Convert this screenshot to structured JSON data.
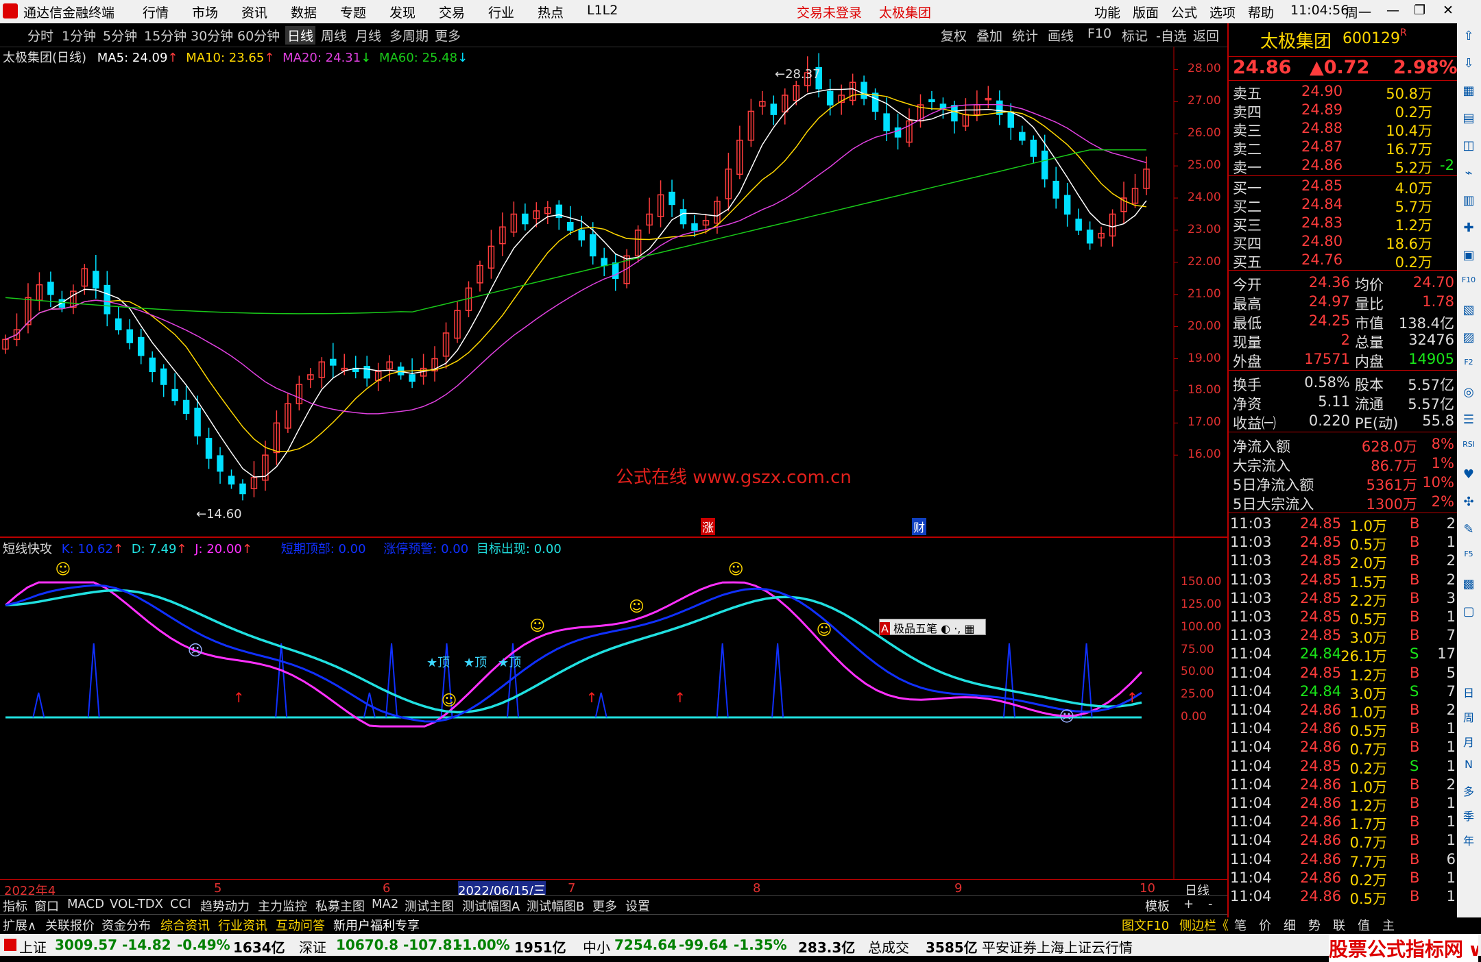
{
  "app": {
    "title": "通达信金融终端",
    "menu": [
      "行情",
      "市场",
      "资讯",
      "数据",
      "专题",
      "发现",
      "交易",
      "行业",
      "热点",
      "L1L2"
    ],
    "trade_status": "交易未登录",
    "stock_title": "太极集团",
    "right_menu": [
      "功能",
      "版面",
      "公式",
      "选项",
      "帮助"
    ],
    "time": "11:04:56",
    "weekday": "周一"
  },
  "tabs": {
    "periods": [
      "分时",
      "1分钟",
      "5分钟",
      "15分钟",
      "30分钟",
      "60分钟",
      "日线",
      "周线",
      "月线",
      "多周期",
      "更多"
    ],
    "selected": "日线",
    "tools": [
      "复权",
      "叠加",
      "统计",
      "画线",
      "F10",
      "标记",
      "-自选",
      "返回"
    ]
  },
  "main_chart": {
    "header": "太极集团(日线)",
    "ma5": "MA5: 24.09",
    "ma10": "MA10: 23.65",
    "ma20": "MA20: 24.31",
    "ma60": "MA60: 25.48",
    "high_label": "28.37",
    "low_label": "14.60",
    "watermark": "公式在线  www.gszx.com.cn",
    "marker_zhang": "涨",
    "marker_cai": "财",
    "y_ticks": [
      "28.00",
      "27.00",
      "26.00",
      "25.00",
      "24.00",
      "23.00",
      "22.00",
      "21.00",
      "20.00",
      "19.00",
      "18.00",
      "17.00",
      "16.00"
    ]
  },
  "sub_chart": {
    "name": "短线快攻",
    "k": "K: 10.62",
    "d": "D: 7.49",
    "j": "J: 20.00",
    "top": "短期顶部: 0.00",
    "limit_up": "涨停预警: 0.00",
    "target": "目标出现: 0.00",
    "top_marks": [
      "★顶",
      "★顶",
      "★顶"
    ],
    "ime": "极品五笔",
    "y_ticks": [
      "150.00",
      "125.00",
      "100.00",
      "75.00",
      "50.00",
      "25.00",
      "0.00"
    ]
  },
  "x_axis": {
    "labels": [
      "2022年4",
      "5",
      "6",
      "2022/06/15/三",
      "7",
      "8",
      "9",
      "10"
    ],
    "tail": "日线"
  },
  "bottom_tabs": [
    "指标",
    "窗口",
    "MACD",
    "VOL-TDX",
    "CCI",
    "趋势动力",
    "主力监控",
    "私募主图",
    "MA2",
    "测试主图",
    "测试幅图A",
    "测试幅图B",
    "更多",
    "设置"
  ],
  "bottom_tabs_right": [
    "模板",
    "+",
    "-"
  ],
  "bottom_links": [
    "扩展∧",
    "关联报价",
    "资金分布",
    "综合资讯",
    "行业资讯",
    "互动问答",
    "新用户福利专享"
  ],
  "bottom_links_right": [
    "图文F10",
    "侧边栏《",
    "笔",
    "价",
    "细",
    "势",
    "联",
    "值",
    "主"
  ],
  "quote": {
    "name": "太极集团",
    "code": "600129",
    "price": "24.86",
    "change": "▲0.72",
    "pct": "2.98%",
    "asks": [
      {
        "label": "卖五",
        "price": "24.90",
        "vol": "50.8万"
      },
      {
        "label": "卖四",
        "price": "24.89",
        "vol": "0.2万"
      },
      {
        "label": "卖三",
        "price": "24.88",
        "vol": "10.4万"
      },
      {
        "label": "卖二",
        "price": "24.87",
        "vol": "16.7万"
      },
      {
        "label": "卖一",
        "price": "24.86",
        "vol": "5.2万"
      }
    ],
    "ask_extra": "-2",
    "bids": [
      {
        "label": "买一",
        "price": "24.85",
        "vol": "4.0万"
      },
      {
        "label": "买二",
        "price": "24.84",
        "vol": "5.7万"
      },
      {
        "label": "买三",
        "price": "24.83",
        "vol": "1.2万"
      },
      {
        "label": "买四",
        "price": "24.80",
        "vol": "18.6万"
      },
      {
        "label": "买五",
        "price": "24.76",
        "vol": "0.2万"
      }
    ],
    "stats": [
      {
        "l1": "今开",
        "v1": "24.36",
        "l2": "均价",
        "v2": "24.70"
      },
      {
        "l1": "最高",
        "v1": "24.97",
        "l2": "量比",
        "v2": "1.78"
      },
      {
        "l1": "最低",
        "v1": "24.25",
        "l2": "市值",
        "v2": "138.4亿"
      },
      {
        "l1": "现量",
        "v1": "2",
        "l2": "总量",
        "v2": "32476"
      },
      {
        "l1": "外盘",
        "v1": "17571",
        "l2": "内盘",
        "v2": "14905"
      }
    ],
    "stats2": [
      {
        "l1": "换手",
        "v1": "0.58%",
        "l2": "股本",
        "v2": "5.57亿"
      },
      {
        "l1": "净资",
        "v1": "5.11",
        "l2": "流通",
        "v2": "5.57亿"
      },
      {
        "l1": "收益㈠",
        "v1": "0.220",
        "l2": "PE(动)",
        "v2": "55.8"
      }
    ],
    "flows": [
      {
        "label": "净流入额",
        "value": "628.0万",
        "pct": "8%"
      },
      {
        "label": "大宗流入",
        "value": "86.7万",
        "pct": "1%"
      },
      {
        "label": "5日净流入额",
        "value": "5361万",
        "pct": "10%"
      },
      {
        "label": "5日大宗流入",
        "value": "1300万",
        "pct": "2%"
      }
    ],
    "ticks": [
      {
        "t": "11:03",
        "p": "24.85",
        "v": "1.0万",
        "s": "B",
        "n": "2"
      },
      {
        "t": "11:03",
        "p": "24.85",
        "v": "0.5万",
        "s": "B",
        "n": "1"
      },
      {
        "t": "11:03",
        "p": "24.85",
        "v": "2.0万",
        "s": "B",
        "n": "2"
      },
      {
        "t": "11:03",
        "p": "24.85",
        "v": "1.5万",
        "s": "B",
        "n": "2"
      },
      {
        "t": "11:03",
        "p": "24.85",
        "v": "2.2万",
        "s": "B",
        "n": "3"
      },
      {
        "t": "11:03",
        "p": "24.85",
        "v": "0.5万",
        "s": "B",
        "n": "1"
      },
      {
        "t": "11:03",
        "p": "24.85",
        "v": "3.0万",
        "s": "B",
        "n": "7"
      },
      {
        "t": "11:04",
        "p": "24.84",
        "v": "26.1万",
        "s": "S",
        "n": "17"
      },
      {
        "t": "11:04",
        "p": "24.85",
        "v": "1.2万",
        "s": "B",
        "n": "5"
      },
      {
        "t": "11:04",
        "p": "24.84",
        "v": "3.0万",
        "s": "S",
        "n": "7"
      },
      {
        "t": "11:04",
        "p": "24.86",
        "v": "1.0万",
        "s": "B",
        "n": "2"
      },
      {
        "t": "11:04",
        "p": "24.86",
        "v": "0.5万",
        "s": "B",
        "n": "1"
      },
      {
        "t": "11:04",
        "p": "24.86",
        "v": "0.7万",
        "s": "B",
        "n": "1"
      },
      {
        "t": "11:04",
        "p": "24.85",
        "v": "0.2万",
        "s": "S",
        "n": "1"
      },
      {
        "t": "11:04",
        "p": "24.86",
        "v": "1.0万",
        "s": "B",
        "n": "2"
      },
      {
        "t": "11:04",
        "p": "24.86",
        "v": "1.2万",
        "s": "B",
        "n": "1"
      },
      {
        "t": "11:04",
        "p": "24.86",
        "v": "1.7万",
        "s": "B",
        "n": "1"
      },
      {
        "t": "11:04",
        "p": "24.86",
        "v": "0.7万",
        "s": "B",
        "n": "1"
      },
      {
        "t": "11:04",
        "p": "24.86",
        "v": "7.7万",
        "s": "B",
        "n": "6"
      },
      {
        "t": "11:04",
        "p": "24.86",
        "v": "0.2万",
        "s": "B",
        "n": "1"
      },
      {
        "t": "11:04",
        "p": "24.86",
        "v": "0.5万",
        "s": "B",
        "n": "1"
      }
    ]
  },
  "sidebar": [
    "日",
    "周",
    "月",
    "N",
    "多",
    "季",
    "年"
  ],
  "status": {
    "sh_label": "上证",
    "sh_val": "3009.57",
    "sh_chg": "-14.82",
    "sh_pct": "-0.49%",
    "sh_amt": "1634亿",
    "sz_label": "深证",
    "sz_val": "10670.8",
    "sz_chg": "-107.81",
    "sz_pct": "-1.00%",
    "sz_amt": "1951亿",
    "zx_label": "中小",
    "zx_val": "7254.64",
    "zx_chg": "-99.64",
    "zx_pct": "-1.35%",
    "zx_amt": "283.3亿",
    "total_label": "总成交",
    "total_amt": "3585亿",
    "broker": "平安证券上海上证云行情"
  },
  "watermark_logo": "股票公式指标网 www.gszx.com.cn",
  "colors": {
    "up": "#ff3c3c",
    "down": "#00e0ff",
    "ma5": "#ffffff",
    "ma10": "#ffd700",
    "ma20": "#e040e0",
    "ma60": "#19c819",
    "k": "#1030ff",
    "d": "#20e0e0",
    "j": "#ff30ff"
  },
  "chart_data": {
    "type": "line",
    "ohlc_note": "daily candlesticks, 2022-04 to 2022-10",
    "close": [
      19.6,
      19.9,
      20.9,
      21.3,
      21.0,
      20.6,
      21.1,
      21.8,
      21.2,
      20.4,
      19.9,
      19.5,
      19.1,
      18.6,
      18.2,
      17.7,
      17.3,
      16.6,
      15.9,
      15.5,
      15.1,
      14.8,
      15.3,
      16.0,
      17.0,
      17.6,
      18.2,
      18.5,
      18.9,
      18.8,
      18.7,
      18.6,
      18.4,
      18.6,
      18.9,
      18.5,
      18.3,
      18.7,
      19.0,
      19.8,
      20.5,
      21.2,
      21.9,
      22.5,
      23.1,
      23.5,
      23.2,
      23.6,
      23.7,
      23.4,
      23.0,
      22.7,
      22.2,
      21.9,
      21.5,
      22.2,
      23.0,
      23.5,
      24.1,
      23.8,
      23.2,
      23.0,
      23.3,
      23.9,
      24.9,
      25.8,
      26.7,
      27.0,
      26.6,
      27.2,
      27.5,
      27.9,
      27.4,
      26.9,
      27.2,
      27.6,
      27.1,
      26.7,
      26.1,
      25.9,
      26.4,
      26.9,
      27.0,
      26.8,
      26.4,
      26.6,
      26.9,
      27.1,
      26.6,
      26.2,
      25.8,
      25.3,
      24.6,
      24.0,
      23.5,
      23.0,
      22.6,
      22.9,
      23.5,
      24.0,
      24.3,
      24.9
    ],
    "ma60_range": [
      20.4,
      25.5
    ],
    "y_range": [
      14.0,
      28.5
    ],
    "indicator": {
      "k_range": [
        0,
        150
      ],
      "note": "K blue, D cyan, J magenta"
    }
  }
}
